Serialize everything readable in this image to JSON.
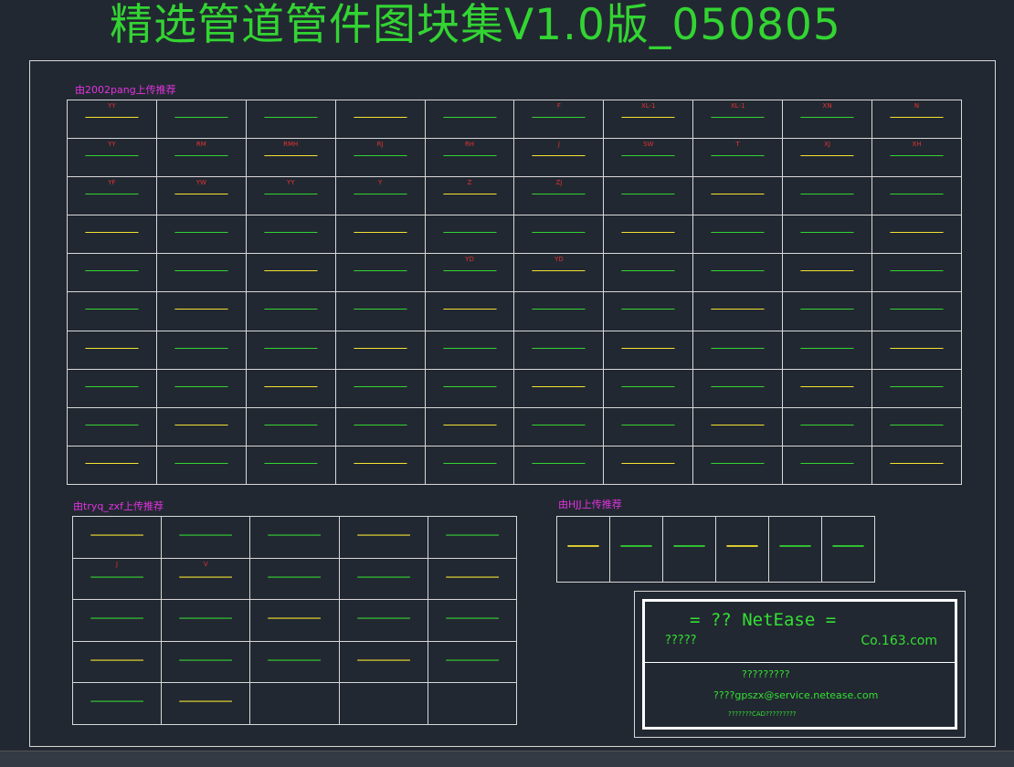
{
  "title": "精选管道管件图块集V1.0版_050805",
  "sections": [
    {
      "title": "由2002pang上传推荐"
    },
    {
      "title": "由tryq_zxf上传推荐"
    },
    {
      "title": "由HJJ上传推荐"
    }
  ],
  "grid1": {
    "rows": 10,
    "cols": 10,
    "cells": [
      {
        "icon": "pipe-icon",
        "labels": [
          "YY"
        ]
      },
      {
        "icon": "wavy-pipe-icon",
        "labels": []
      },
      {
        "icon": "double-pipe-icon",
        "labels": []
      },
      {
        "icon": "pipe-icon",
        "labels": []
      },
      {
        "icon": "sleeve-icon",
        "labels": []
      },
      {
        "icon": "pipe-icon",
        "labels": [
          "F"
        ]
      },
      {
        "icon": "pipe-icon",
        "labels": [
          "XL-1"
        ]
      },
      {
        "icon": "pipe-icon",
        "labels": [
          "XL-1"
        ]
      },
      {
        "icon": "pipe-icon",
        "labels": [
          "XN"
        ]
      },
      {
        "icon": "pipe-icon",
        "labels": [
          "N"
        ]
      },
      {
        "icon": "pipe-icon",
        "labels": [
          "YY"
        ]
      },
      {
        "icon": "pipe-icon",
        "labels": [
          "RM"
        ]
      },
      {
        "icon": "pipe-icon",
        "labels": [
          "RMH"
        ]
      },
      {
        "icon": "pipe-icon",
        "labels": [
          "RJ"
        ]
      },
      {
        "icon": "pipe-icon",
        "labels": [
          "RH"
        ]
      },
      {
        "icon": "pipe-icon",
        "labels": [
          "J"
        ]
      },
      {
        "icon": "pipe-icon",
        "labels": [
          "SW"
        ]
      },
      {
        "icon": "pipe-icon",
        "labels": [
          "T"
        ]
      },
      {
        "icon": "pipe-icon",
        "labels": [
          "XJ"
        ]
      },
      {
        "icon": "pipe-icon",
        "labels": [
          "XH"
        ]
      },
      {
        "icon": "pipe-icon",
        "labels": [
          "YF"
        ]
      },
      {
        "icon": "pipe-icon",
        "labels": [
          "YW"
        ]
      },
      {
        "icon": "pipe-icon",
        "labels": [
          "YY"
        ]
      },
      {
        "icon": "pipe-icon",
        "labels": [
          "Y"
        ]
      },
      {
        "icon": "pipe-icon",
        "labels": [
          "Z"
        ]
      },
      {
        "icon": "pipe-icon",
        "labels": [
          "ZJ"
        ]
      },
      {
        "icon": "pipe-icon",
        "labels": []
      },
      {
        "icon": "pipe-icon",
        "labels": []
      },
      {
        "icon": "pipe-icon",
        "labels": []
      },
      {
        "icon": "pipe-icon",
        "labels": []
      },
      {
        "icon": "pipe-icon",
        "labels": []
      },
      {
        "icon": "pipe-icon",
        "labels": []
      },
      {
        "icon": "pipe-icon",
        "labels": []
      },
      {
        "icon": "pipe-icon",
        "labels": []
      },
      {
        "icon": "pipe-icon",
        "labels": []
      },
      {
        "icon": "pipe-icon",
        "labels": []
      },
      {
        "icon": "pipe-icon",
        "labels": []
      },
      {
        "icon": "pipe-icon",
        "labels": []
      },
      {
        "icon": "pipe-icon",
        "labels": []
      },
      {
        "icon": "pipe-icon",
        "labels": []
      },
      {
        "icon": "pipe-icon",
        "labels": []
      },
      {
        "icon": "pipe-icon",
        "labels": []
      },
      {
        "icon": "pipe-icon",
        "labels": []
      },
      {
        "icon": "pipe-icon",
        "labels": []
      },
      {
        "icon": "pipe-icon",
        "labels": [
          "YD"
        ]
      },
      {
        "icon": "pipe-icon",
        "labels": [
          "YD"
        ]
      },
      {
        "icon": "pipe-icon",
        "labels": []
      },
      {
        "icon": "pipe-icon",
        "labels": []
      },
      {
        "icon": "pipe-icon",
        "labels": []
      },
      {
        "icon": "pipe-icon",
        "labels": []
      },
      {
        "icon": "pipe-icon",
        "labels": []
      },
      {
        "icon": "pipe-icon",
        "labels": []
      },
      {
        "icon": "pipe-icon",
        "labels": []
      },
      {
        "icon": "pipe-icon",
        "labels": []
      },
      {
        "icon": "pipe-icon",
        "labels": []
      },
      {
        "icon": "pipe-icon",
        "labels": []
      },
      {
        "icon": "pipe-icon",
        "labels": []
      },
      {
        "icon": "pipe-icon",
        "labels": []
      },
      {
        "icon": "pipe-icon",
        "labels": []
      },
      {
        "icon": "pipe-icon",
        "labels": []
      },
      {
        "icon": "pipe-icon",
        "labels": []
      },
      {
        "icon": "pipe-icon",
        "labels": []
      },
      {
        "icon": "pipe-icon",
        "labels": []
      },
      {
        "icon": "pipe-icon",
        "labels": []
      },
      {
        "icon": "pipe-icon",
        "labels": []
      },
      {
        "icon": "pipe-icon",
        "labels": []
      },
      {
        "icon": "pipe-icon",
        "labels": []
      },
      {
        "icon": "pipe-icon",
        "labels": []
      },
      {
        "icon": "pipe-icon",
        "labels": []
      },
      {
        "icon": "pipe-icon",
        "labels": []
      },
      {
        "icon": "pipe-icon",
        "labels": []
      },
      {
        "icon": "pipe-icon",
        "labels": []
      },
      {
        "icon": "pipe-icon",
        "labels": []
      },
      {
        "icon": "pipe-icon",
        "labels": []
      },
      {
        "icon": "pipe-icon",
        "labels": []
      },
      {
        "icon": "pipe-icon",
        "labels": []
      },
      {
        "icon": "pipe-icon",
        "labels": []
      },
      {
        "icon": "pipe-icon",
        "labels": []
      },
      {
        "icon": "pipe-icon",
        "labels": []
      },
      {
        "icon": "pipe-icon",
        "labels": []
      },
      {
        "icon": "pipe-icon",
        "labels": []
      },
      {
        "icon": "pipe-icon",
        "labels": []
      },
      {
        "icon": "pipe-icon",
        "labels": []
      },
      {
        "icon": "pipe-icon",
        "labels": []
      },
      {
        "icon": "pipe-icon",
        "labels": []
      },
      {
        "icon": "pipe-icon",
        "labels": []
      },
      {
        "icon": "pipe-icon",
        "labels": []
      },
      {
        "icon": "pipe-icon",
        "labels": []
      },
      {
        "icon": "pipe-icon",
        "labels": []
      },
      {
        "icon": "pipe-icon",
        "labels": []
      },
      {
        "icon": "pipe-icon",
        "labels": []
      },
      {
        "icon": "pipe-icon",
        "labels": []
      },
      {
        "icon": "pipe-icon",
        "labels": []
      },
      {
        "icon": "pipe-icon",
        "labels": []
      },
      {
        "icon": "pipe-icon",
        "labels": []
      },
      {
        "icon": "pipe-icon",
        "labels": []
      },
      {
        "icon": "pipe-icon",
        "labels": []
      },
      {
        "icon": "pipe-icon",
        "labels": []
      },
      {
        "icon": "pipe-icon",
        "labels": []
      },
      {
        "icon": "pipe-icon",
        "labels": []
      }
    ]
  },
  "grid2": {
    "rows": 5,
    "cols": 5,
    "cells": [
      {
        "icon": "pipe-icon",
        "labels": []
      },
      {
        "icon": "pipe-icon",
        "labels": []
      },
      {
        "icon": "pipe-icon",
        "labels": []
      },
      {
        "icon": "pipe-icon",
        "labels": []
      },
      {
        "icon": "pipe-icon",
        "labels": []
      },
      {
        "icon": "pipe-icon",
        "labels": [
          "J"
        ]
      },
      {
        "icon": "pipe-icon",
        "labels": [
          "V"
        ]
      },
      {
        "icon": "pipe-icon",
        "labels": []
      },
      {
        "icon": "pipe-icon",
        "labels": []
      },
      {
        "icon": "pipe-icon",
        "labels": []
      },
      {
        "icon": "pipe-icon",
        "labels": []
      },
      {
        "icon": "pipe-icon",
        "labels": []
      },
      {
        "icon": "pipe-icon",
        "labels": []
      },
      {
        "icon": "pipe-icon",
        "labels": []
      },
      {
        "icon": "pipe-icon",
        "labels": []
      },
      {
        "icon": "pipe-icon",
        "labels": []
      },
      {
        "icon": "pipe-icon",
        "labels": []
      },
      {
        "icon": "pipe-icon",
        "labels": []
      },
      {
        "icon": "pipe-icon",
        "labels": []
      },
      {
        "icon": "pipe-icon",
        "labels": []
      },
      {
        "icon": "pipe-icon",
        "labels": []
      },
      {
        "icon": "pipe-icon",
        "labels": []
      }
    ]
  },
  "grid3": {
    "rows": 1,
    "cols": 6,
    "cells": [
      {
        "icon": "pipe-icon",
        "labels": []
      },
      {
        "icon": "pipe-icon",
        "labels": []
      },
      {
        "icon": "pipe-icon",
        "labels": []
      },
      {
        "icon": "pipe-icon",
        "labels": []
      },
      {
        "icon": "pipe-icon",
        "labels": []
      },
      {
        "icon": "pipe-icon",
        "labels": []
      }
    ]
  },
  "netease": {
    "title": "=  ?? NetEase   =",
    "left": "?????",
    "right": "Co.163.com",
    "line1": "?????????",
    "line2": "????gpszx@service.netease.com",
    "line3": "???????CAD?????????"
  }
}
